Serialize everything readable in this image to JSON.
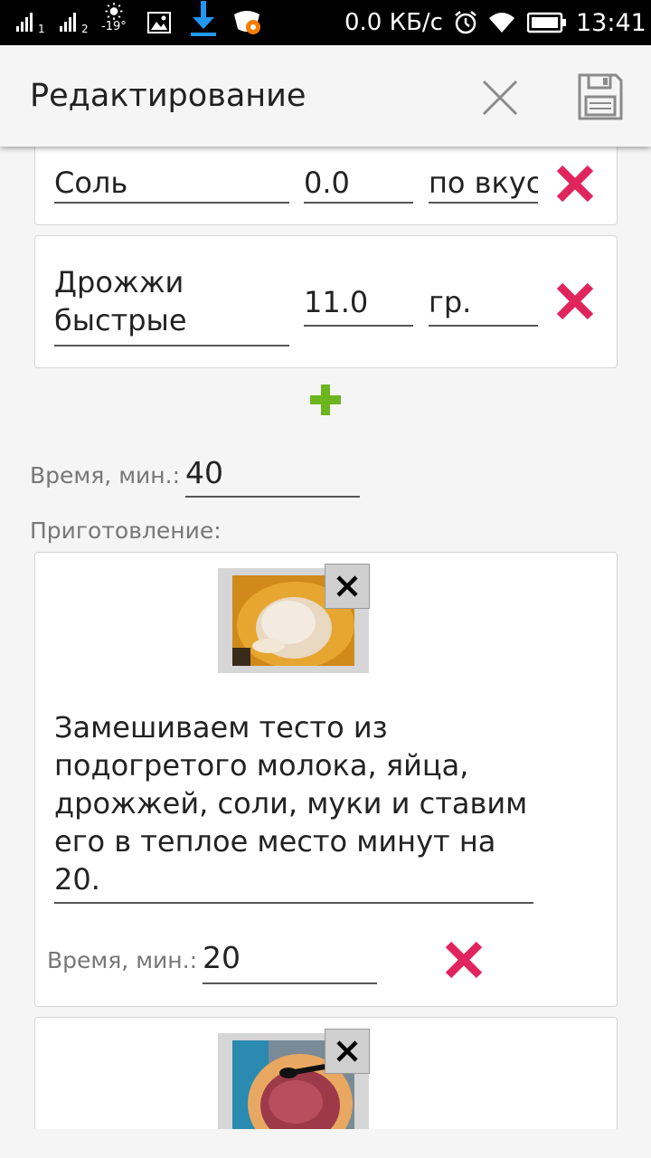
{
  "status_bar": {
    "sim1_label": "1",
    "sim2_label": "2",
    "temperature": "-19°",
    "net_speed": "0.0 КБ/с",
    "time": "13:41"
  },
  "app_bar": {
    "title": "Редактирование",
    "close_icon": "close-icon",
    "save_icon": "save-icon"
  },
  "ingredients": [
    {
      "name": "Соль",
      "amount": "0.0",
      "unit": "по вкус"
    },
    {
      "name_line1": "Дрожжи",
      "name_line2": "быстрые",
      "amount": "11.0",
      "unit": "гр."
    }
  ],
  "add_ingredient_icon": "plus-icon",
  "total_time": {
    "label": "Время, мин.:",
    "value": "40"
  },
  "preparation_label": "Приготовление:",
  "steps": [
    {
      "text_lines": [
        "Замешиваем тесто из",
        "подогретого молока, яйца,",
        "дрожжей, соли, муки и ставим",
        "его в теплое место минут на",
        "20."
      ],
      "time_label": "Время, мин.:",
      "time_value": "20"
    },
    {}
  ],
  "colors": {
    "status_bar": "#000000",
    "app_bar": "#f5f5f5",
    "delete_x": "#e0245e",
    "add_plus": "#6cb51f",
    "download_icon": "#2196f3"
  }
}
